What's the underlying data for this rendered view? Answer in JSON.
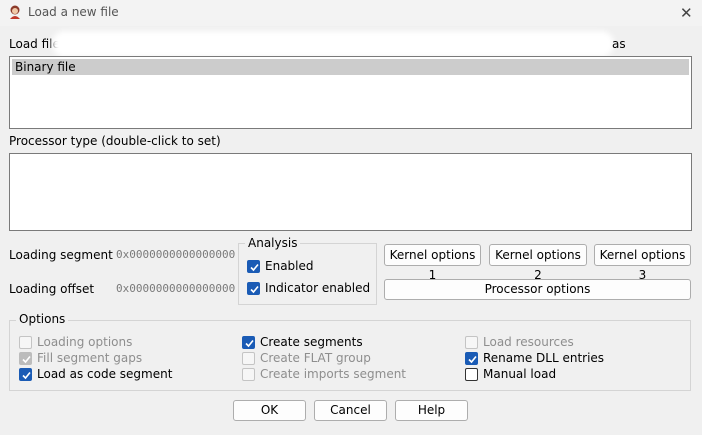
{
  "window": {
    "title": "Load a new file",
    "close_glyph": "✕"
  },
  "load_file": {
    "label_prefix": "Load file",
    "label_suffix": "as",
    "formats": [
      "Binary file"
    ]
  },
  "processor": {
    "label": "Processor type (double-click to set)"
  },
  "loading": {
    "segment_label": "Loading segment",
    "segment_value": "0x0000000000000000",
    "offset_label": "Loading offset",
    "offset_value": "0x0000000000000000"
  },
  "analysis": {
    "legend": "Analysis",
    "enabled_label": "Enabled",
    "enabled_checked": true,
    "indicator_label": "Indicator enabled",
    "indicator_checked": true
  },
  "kernel_buttons": [
    "Kernel options 1",
    "Kernel options 2",
    "Kernel options 3"
  ],
  "processor_options_label": "Processor options",
  "options": {
    "legend": "Options",
    "items": [
      {
        "label": "Loading options",
        "checked": false,
        "enabled": false
      },
      {
        "label": "Fill segment gaps",
        "checked": true,
        "enabled": false
      },
      {
        "label": "Load as code segment",
        "checked": true,
        "enabled": true
      },
      {
        "label": "Create segments",
        "checked": true,
        "enabled": true
      },
      {
        "label": "Create FLAT group",
        "checked": false,
        "enabled": false
      },
      {
        "label": "Create imports segment",
        "checked": false,
        "enabled": false
      },
      {
        "label": "Load resources",
        "checked": false,
        "enabled": false
      },
      {
        "label": "Rename DLL entries",
        "checked": true,
        "enabled": true
      },
      {
        "label": "Manual load",
        "checked": false,
        "enabled": true
      }
    ]
  },
  "dialog_buttons": {
    "ok": "OK",
    "cancel": "Cancel",
    "help": "Help"
  },
  "colors": {
    "accent": "#1a5bb5",
    "selection": "#cccccc",
    "background": "#f0f0f0"
  }
}
